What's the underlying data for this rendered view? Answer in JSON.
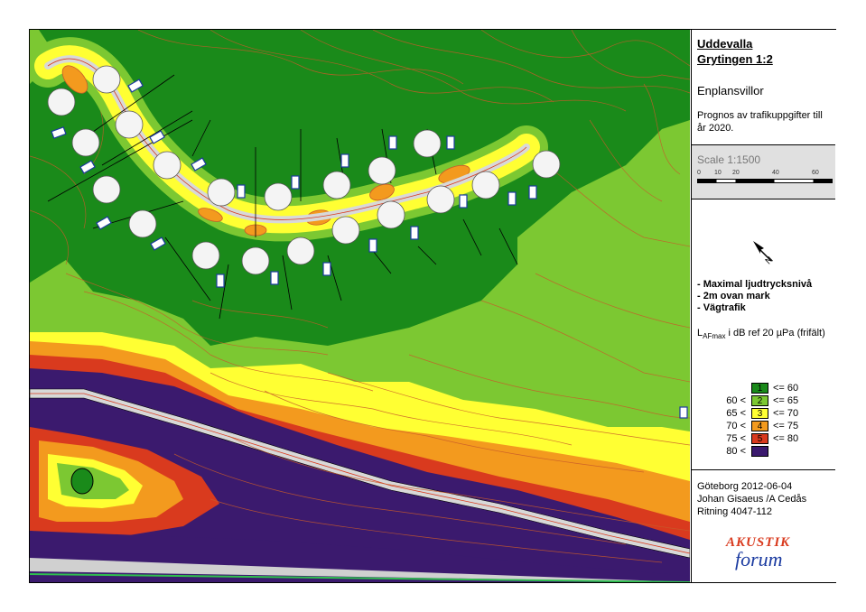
{
  "title": {
    "line1": "Uddevalla",
    "line2": "Grytingen 1:2",
    "subtitle": "Enplansvillor",
    "description": "Prognos av trafikuppgifter till år 2020."
  },
  "scale": {
    "label": "Scale 1:1500",
    "ticks": [
      "0",
      "10",
      "20",
      "40",
      "60"
    ]
  },
  "north_icon": "north-arrow-icon",
  "legend": {
    "bullets": [
      "- Maximal ljudtrycksnivå",
      "- 2m ovan mark",
      "- Vägtrafik"
    ],
    "quantity_main": "L",
    "quantity_sub": "AFmax",
    "quantity_rest": " i dB ref 20 µPa (frifält)",
    "classes": [
      {
        "num": "1",
        "left": "",
        "right": "<= 60",
        "color": "#1a8a1a"
      },
      {
        "num": "2",
        "left": "60 <",
        "right": "<= 65",
        "color": "#7cc832"
      },
      {
        "num": "3",
        "left": "65 <",
        "right": "<= 70",
        "color": "#ffff33"
      },
      {
        "num": "4",
        "left": "70 <",
        "right": "<= 75",
        "color": "#f39a1e"
      },
      {
        "num": "5",
        "left": "75 <",
        "right": "<= 80",
        "color": "#d93a1e"
      },
      {
        "num": "",
        "left": "80 <",
        "right": "",
        "color": "#3b1a6e"
      }
    ]
  },
  "footer": {
    "date": "Göteborg 2012-06-04",
    "authors": "Johan Gisaeus /A Cedås",
    "drawing": "Ritning 4047-112"
  },
  "logo": {
    "line1": "AKUSTIK",
    "line2": "forum"
  },
  "colors": {
    "zone1": "#1a8a1a",
    "zone2": "#7cc832",
    "zone3": "#ffff33",
    "zone4": "#f39a1e",
    "zone5": "#d93a1e",
    "zone6": "#3b1a6e",
    "contour": "#c85a2a"
  }
}
